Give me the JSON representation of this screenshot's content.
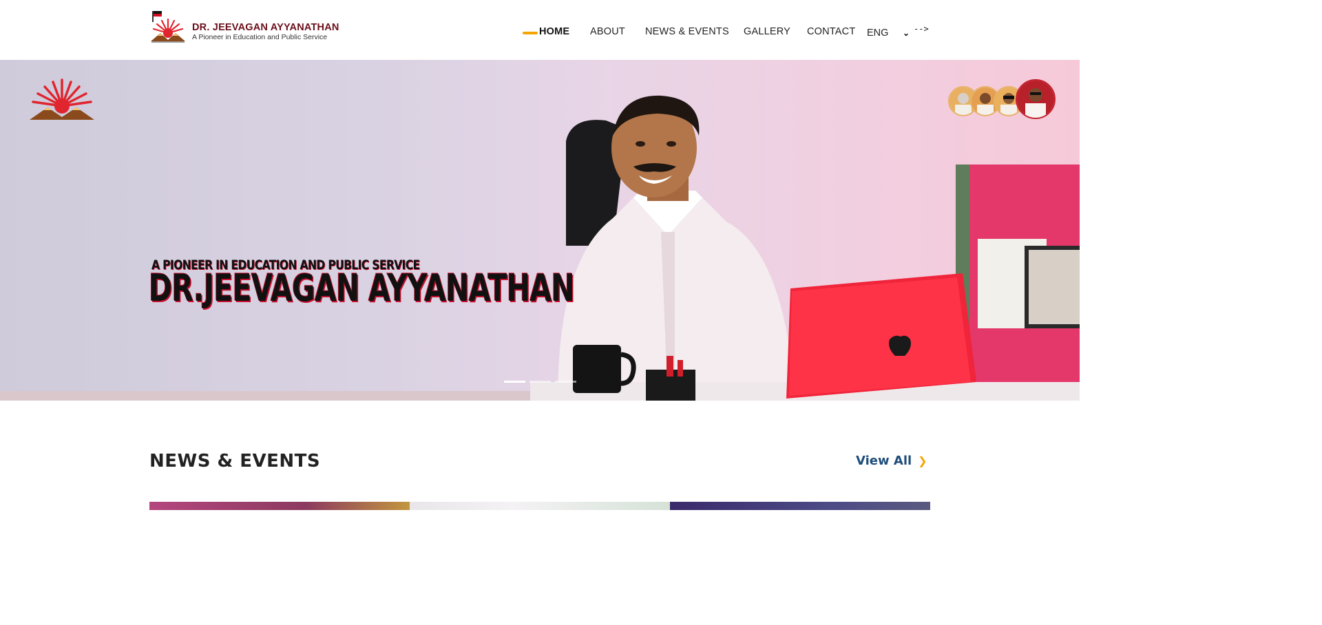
{
  "brand": {
    "title": "DR. JEEVAGAN AYYANATHAN",
    "subtitle": "A Pioneer in Education and Public Service"
  },
  "nav": {
    "items": [
      {
        "label": "HOME",
        "active": true
      },
      {
        "label": "ABOUT",
        "active": false
      },
      {
        "label": "NEWS & EVENTS",
        "active": false
      },
      {
        "label": "GALLERY",
        "active": false
      },
      {
        "label": "CONTACT",
        "active": false
      }
    ],
    "language": "ENG",
    "stray_text": "-->"
  },
  "hero": {
    "tagline": "A PIONEER IN EDUCATION AND PUBLIC SERVICE",
    "name": "DR.JEEVAGAN AYYANATHAN",
    "slides": 3,
    "active_slide": 1
  },
  "news": {
    "heading": "NEWS & EVENTS",
    "view_all": "View All"
  },
  "colors": {
    "accent": "#f5a300",
    "brand_red": "#c8102e",
    "brand_maroon": "#6b0f1a",
    "link_blue": "#1e4d7a"
  }
}
